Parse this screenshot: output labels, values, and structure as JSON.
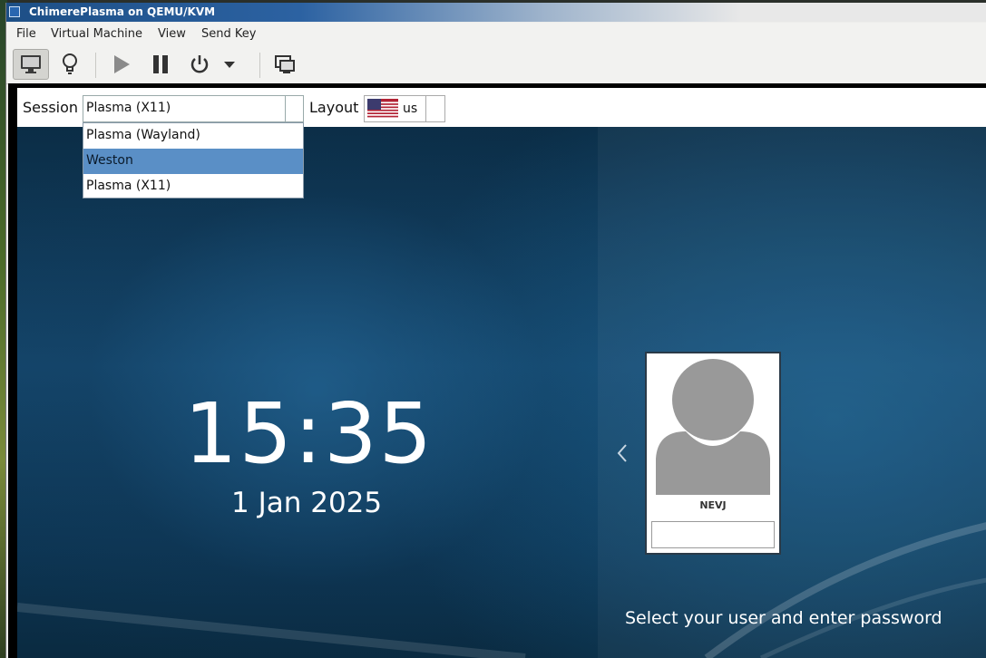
{
  "window": {
    "title": "ChimerePlasma on QEMU/KVM"
  },
  "menubar": {
    "items": [
      "File",
      "Virtual Machine",
      "View",
      "Send Key"
    ]
  },
  "toolbar": {
    "buttons": [
      {
        "icon": "monitor-icon",
        "active": true
      },
      {
        "icon": "lightbulb-icon",
        "active": false
      },
      {
        "icon": "play-icon",
        "active": false
      },
      {
        "icon": "pause-icon",
        "active": false
      },
      {
        "icon": "power-icon",
        "active": false
      },
      {
        "icon": "chevron-down-icon",
        "active": false
      },
      {
        "icon": "screenshot-icon",
        "active": false
      }
    ]
  },
  "login": {
    "session_label": "Session",
    "session_value": "Plasma (X11)",
    "layout_label": "Layout",
    "layout_value": "us",
    "layout_flag": "us-flag-icon",
    "session_options": [
      "Plasma (Wayland)",
      "Weston",
      "Plasma (X11)"
    ],
    "highlighted_option": "Weston",
    "time": "15:35",
    "date": "1 Jan 2025",
    "username": "NEVJ",
    "instruction": "Select your user and enter password"
  },
  "colors": {
    "titlebar": "#1d4f86",
    "highlight": "#5a8fc6",
    "wallpaper": "#14456a"
  }
}
